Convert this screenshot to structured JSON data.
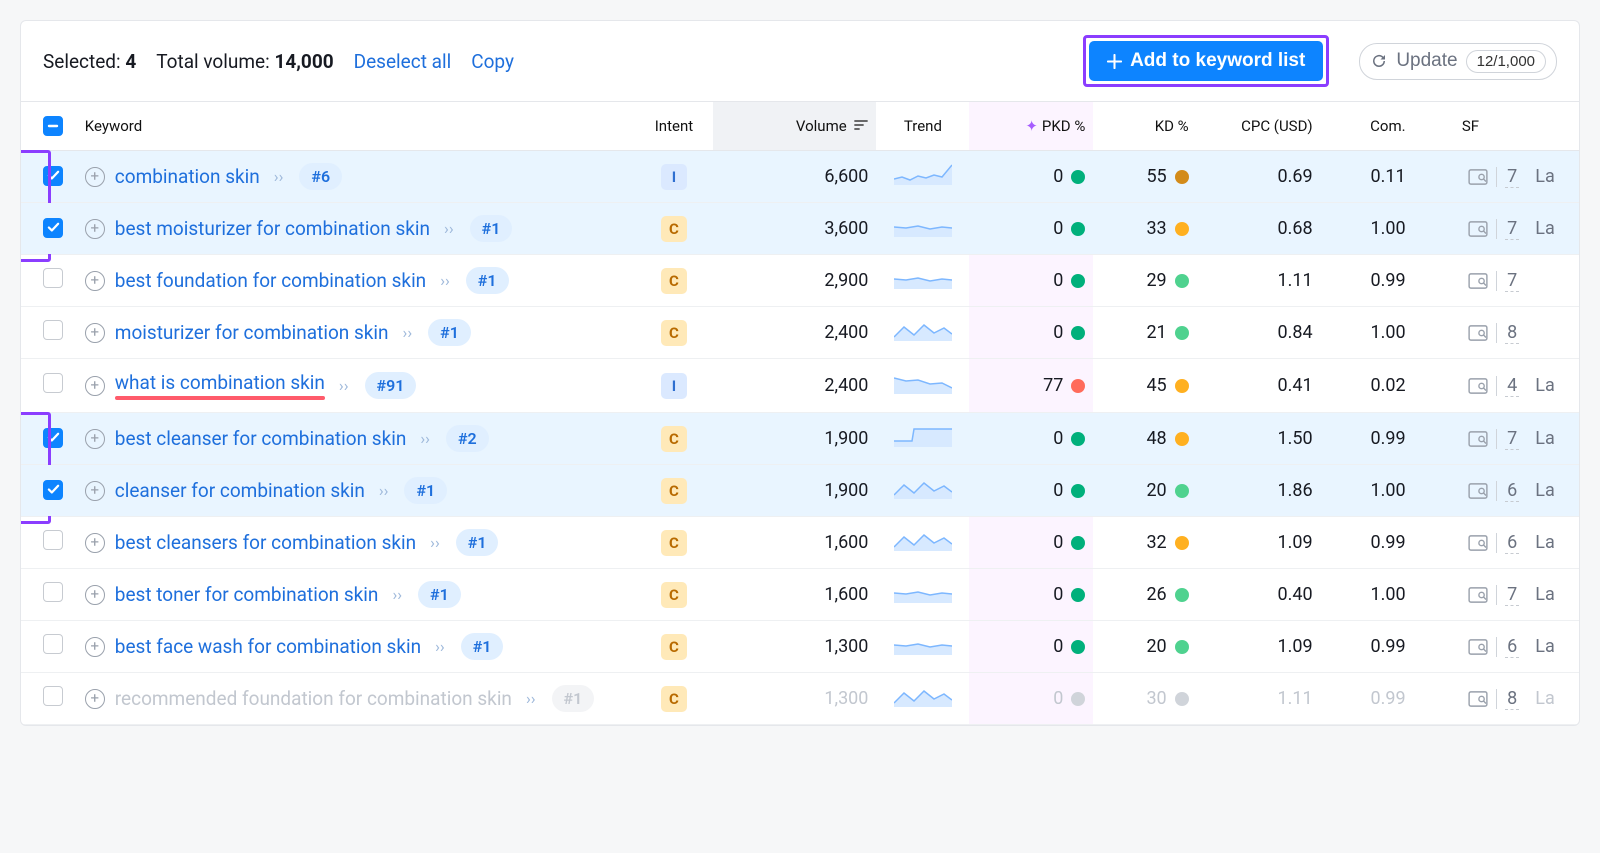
{
  "topbar": {
    "selected_label": "Selected:",
    "selected_count": "4",
    "total_volume_label": "Total volume:",
    "total_volume": "14,000",
    "deselect": "Deselect all",
    "copy": "Copy",
    "add_btn": "Add to keyword list",
    "update": "Update",
    "counter": "12/1,000"
  },
  "columns": {
    "keyword": "Keyword",
    "intent": "Intent",
    "volume": "Volume",
    "trend": "Trend",
    "pkd": "PKD %",
    "kd": "KD %",
    "cpc": "CPC (USD)",
    "com": "Com.",
    "sf": "SF"
  },
  "rows": [
    {
      "checked": true,
      "hl": "top",
      "keyword": "combination skin",
      "rank": "#6",
      "intent": "I",
      "volume": "6,600",
      "trend": "up",
      "pkd": "0",
      "pkdColor": "green",
      "kd": "55",
      "kdColor": "darkorange",
      "cpc": "0.69",
      "com": "0.11",
      "sf": "7",
      "over": "La"
    },
    {
      "checked": true,
      "hl": "bottom",
      "keyword": "best moisturizer for combination skin",
      "rank": "#1",
      "intent": "C",
      "volume": "3,600",
      "trend": "flat",
      "pkd": "0",
      "pkdColor": "green",
      "kd": "33",
      "kdColor": "orange",
      "cpc": "0.68",
      "com": "1.00",
      "sf": "7",
      "over": "La"
    },
    {
      "checked": false,
      "keyword": "best foundation for combination skin",
      "rank": "#1",
      "intent": "C",
      "intentSolid": true,
      "volume": "2,900",
      "trend": "flat",
      "pkd": "0",
      "pkdColor": "green",
      "kd": "29",
      "kdColor": "lightgreen",
      "cpc": "1.11",
      "com": "0.99",
      "sf": "7"
    },
    {
      "checked": false,
      "keyword": "moisturizer for combination skin",
      "rank": "#1",
      "intent": "C",
      "intentSolid": true,
      "volume": "2,400",
      "trend": "vary",
      "pkd": "0",
      "pkdColor": "green",
      "kd": "21",
      "kdColor": "lightgreen",
      "cpc": "0.84",
      "com": "1.00",
      "sf": "8"
    },
    {
      "checked": false,
      "keyword": "what is combination skin",
      "underline": true,
      "rank": "#91",
      "intent": "I",
      "volume": "2,400",
      "trend": "down",
      "pkd": "77",
      "pkdColor": "red",
      "kd": "45",
      "kdColor": "orange",
      "cpc": "0.41",
      "com": "0.02",
      "sf": "4",
      "over": "La"
    },
    {
      "checked": true,
      "hl": "top",
      "keyword": "best cleanser for combination skin",
      "rank": "#2",
      "intent": "C",
      "volume": "1,900",
      "trend": "step",
      "pkd": "0",
      "pkdColor": "green",
      "kd": "48",
      "kdColor": "orange",
      "cpc": "1.50",
      "com": "0.99",
      "sf": "7",
      "over": "La"
    },
    {
      "checked": true,
      "hl": "bottom",
      "keyword": "cleanser for combination skin",
      "rank": "#1",
      "intent": "C",
      "volume": "1,900",
      "trend": "vary",
      "pkd": "0",
      "pkdColor": "green",
      "kd": "20",
      "kdColor": "lightgreen",
      "cpc": "1.86",
      "com": "1.00",
      "sf": "6",
      "over": "La"
    },
    {
      "checked": false,
      "keyword": "best cleansers for combination skin",
      "rank": "#1",
      "intent": "C",
      "intentSolid": true,
      "volume": "1,600",
      "trend": "vary",
      "pkd": "0",
      "pkdColor": "green",
      "kd": "32",
      "kdColor": "orange",
      "cpc": "1.09",
      "com": "0.99",
      "sf": "6",
      "over": "La"
    },
    {
      "checked": false,
      "keyword": "best toner for combination skin",
      "rank": "#1",
      "intent": "C",
      "intentSolid": true,
      "volume": "1,600",
      "trend": "flat",
      "pkd": "0",
      "pkdColor": "green",
      "kd": "26",
      "kdColor": "lightgreen",
      "cpc": "0.40",
      "com": "1.00",
      "sf": "7",
      "over": "La"
    },
    {
      "checked": false,
      "keyword": "best face wash for combination skin",
      "rank": "#1",
      "intent": "C",
      "intentSolid": true,
      "volume": "1,300",
      "trend": "flat",
      "pkd": "0",
      "pkdColor": "green",
      "kd": "20",
      "kdColor": "lightgreen",
      "cpc": "1.09",
      "com": "0.99",
      "sf": "6",
      "over": "La"
    },
    {
      "checked": false,
      "faded": true,
      "keyword": "recommended foundation for combination skin",
      "rank": "#1",
      "intent": "C",
      "intentSolid": true,
      "volume": "1,300",
      "trend": "vary",
      "pkd": "0",
      "pkdColor": "grey",
      "kd": "30",
      "kdColor": "grey",
      "cpc": "1.11",
      "com": "0.99",
      "sf": "8",
      "over": "La"
    }
  ]
}
